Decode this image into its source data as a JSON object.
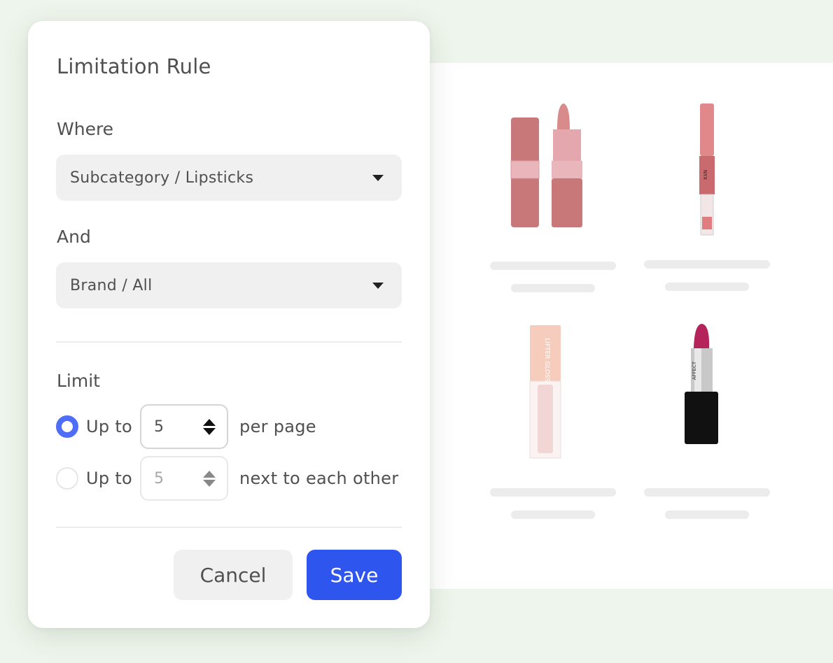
{
  "dialog": {
    "title": "Limitation Rule",
    "where": {
      "label": "Where",
      "selected": "Subcategory / Lipsticks"
    },
    "and": {
      "label": "And",
      "selected": "Brand / All"
    },
    "limit": {
      "label": "Limit",
      "options": [
        {
          "prefix": "Up to",
          "value": "5",
          "suffix": "per page",
          "checked": true,
          "enabled": true
        },
        {
          "prefix": "Up to",
          "value": "5",
          "suffix": "next to each other",
          "checked": false,
          "enabled": false
        }
      ]
    },
    "buttons": {
      "cancel": "Cancel",
      "save": "Save"
    }
  },
  "products": [
    {
      "name": "nude-pink-lipstick",
      "brand_text": ""
    },
    {
      "name": "nyx-liquid-lipstick",
      "brand_text": "NYX"
    },
    {
      "name": "maybelline-lifter-gloss",
      "brand_text": "LIFTER GLOSS"
    },
    {
      "name": "affect-magenta-lipstick",
      "brand_text": "AFFECT"
    }
  ],
  "colors": {
    "accent": "#2f55ef",
    "radio_checked": "#4f6ef7",
    "background": "#eef5ec",
    "select_bg": "#f0f0f0"
  }
}
